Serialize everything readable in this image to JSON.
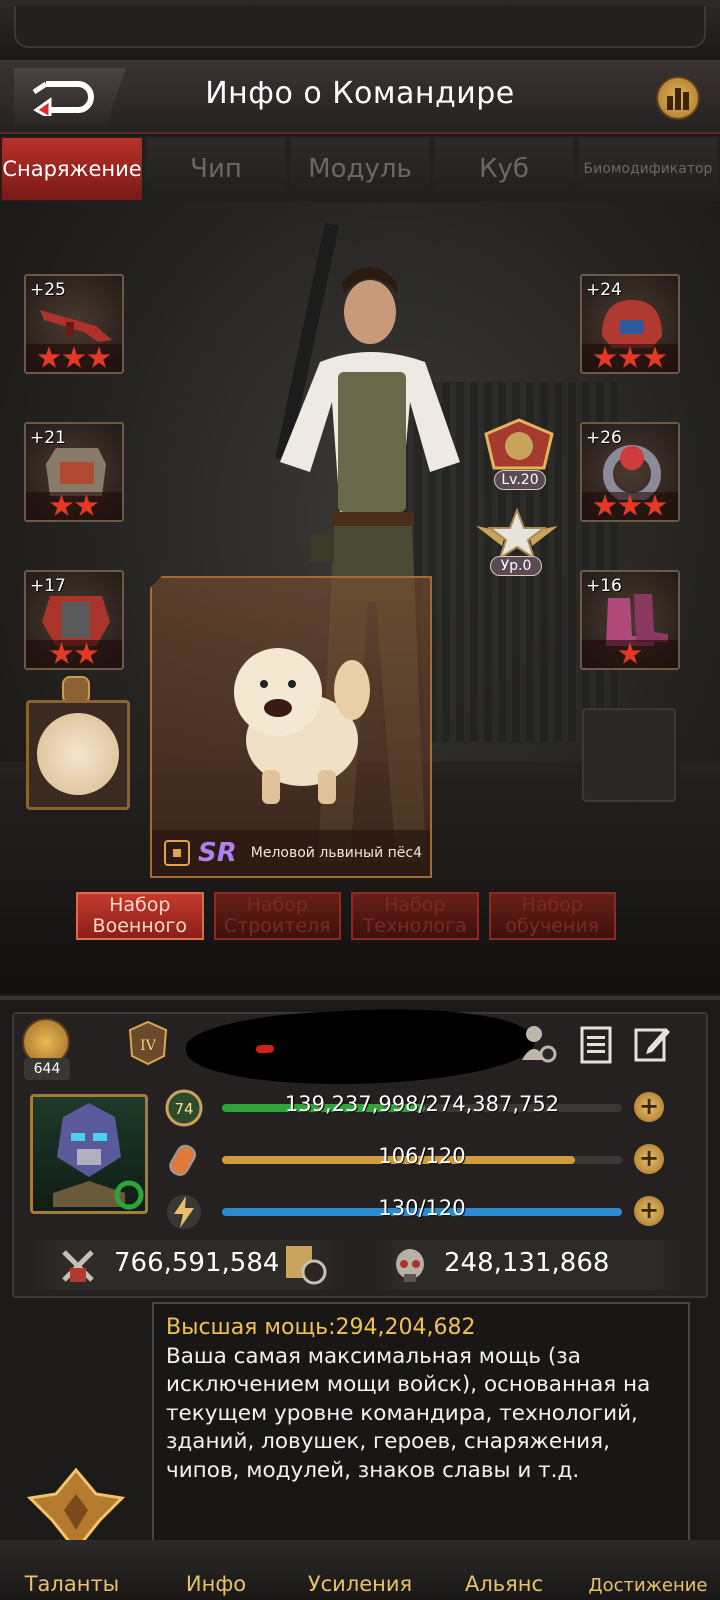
{
  "header": {
    "title": "Инфо о Командире"
  },
  "tabs": [
    {
      "label": "Снаряжение",
      "active": true
    },
    {
      "label": "Чип"
    },
    {
      "label": "Модуль"
    },
    {
      "label": "Куб"
    },
    {
      "label": "Биомодификатор"
    }
  ],
  "gear_left": [
    {
      "level": "+25",
      "stars": 3,
      "icon": "rifle-icon"
    },
    {
      "level": "+21",
      "stars": 2,
      "icon": "armor-plate-icon"
    },
    {
      "level": "+17",
      "stars": 2,
      "icon": "body-armor-icon"
    }
  ],
  "gear_right": [
    {
      "level": "+24",
      "stars": 3,
      "icon": "helmet-icon"
    },
    {
      "level": "+26",
      "stars": 3,
      "icon": "ring-icon"
    },
    {
      "level": "+16",
      "stars": 1,
      "icon": "boots-icon"
    }
  ],
  "badges": {
    "gear_level": "Lv.20",
    "rank_level": "Ур.0"
  },
  "pet": {
    "rarity": "SR",
    "name": "Меловой львиный пёс4"
  },
  "sets": [
    "Набор Военного",
    "Набор Строителя",
    "Набор Технолога",
    "Набор обучения"
  ],
  "profile": {
    "likes": "644",
    "rank_roman": "IV",
    "level": "74",
    "bars": [
      {
        "text": "139,237,998/274,387,752",
        "fraction": 0.507,
        "color": "#2fa43a",
        "icon": "level-icon"
      },
      {
        "text": "106/120",
        "fraction": 0.883,
        "color": "#d09a3e",
        "icon": "stamina-icon"
      },
      {
        "text": "130/120",
        "fraction": 1.0,
        "color": "#2d8ad0",
        "icon": "energy-icon"
      }
    ],
    "power": "766,591,584",
    "kills": "248,131,868"
  },
  "tooltip": {
    "heading": "Высшая мощь:294,204,682",
    "body": "Ваша самая максимальная мощь (за исключением мощи войск), основанная на текущем уровне командира, технологий, зданий, ловушек, героев, снаряжения, чипов, модулей, знаков славы и т.д."
  },
  "bottom_nav": [
    "Таланты",
    "Инфо",
    "Усиления",
    "Альянс",
    "Достижение"
  ]
}
